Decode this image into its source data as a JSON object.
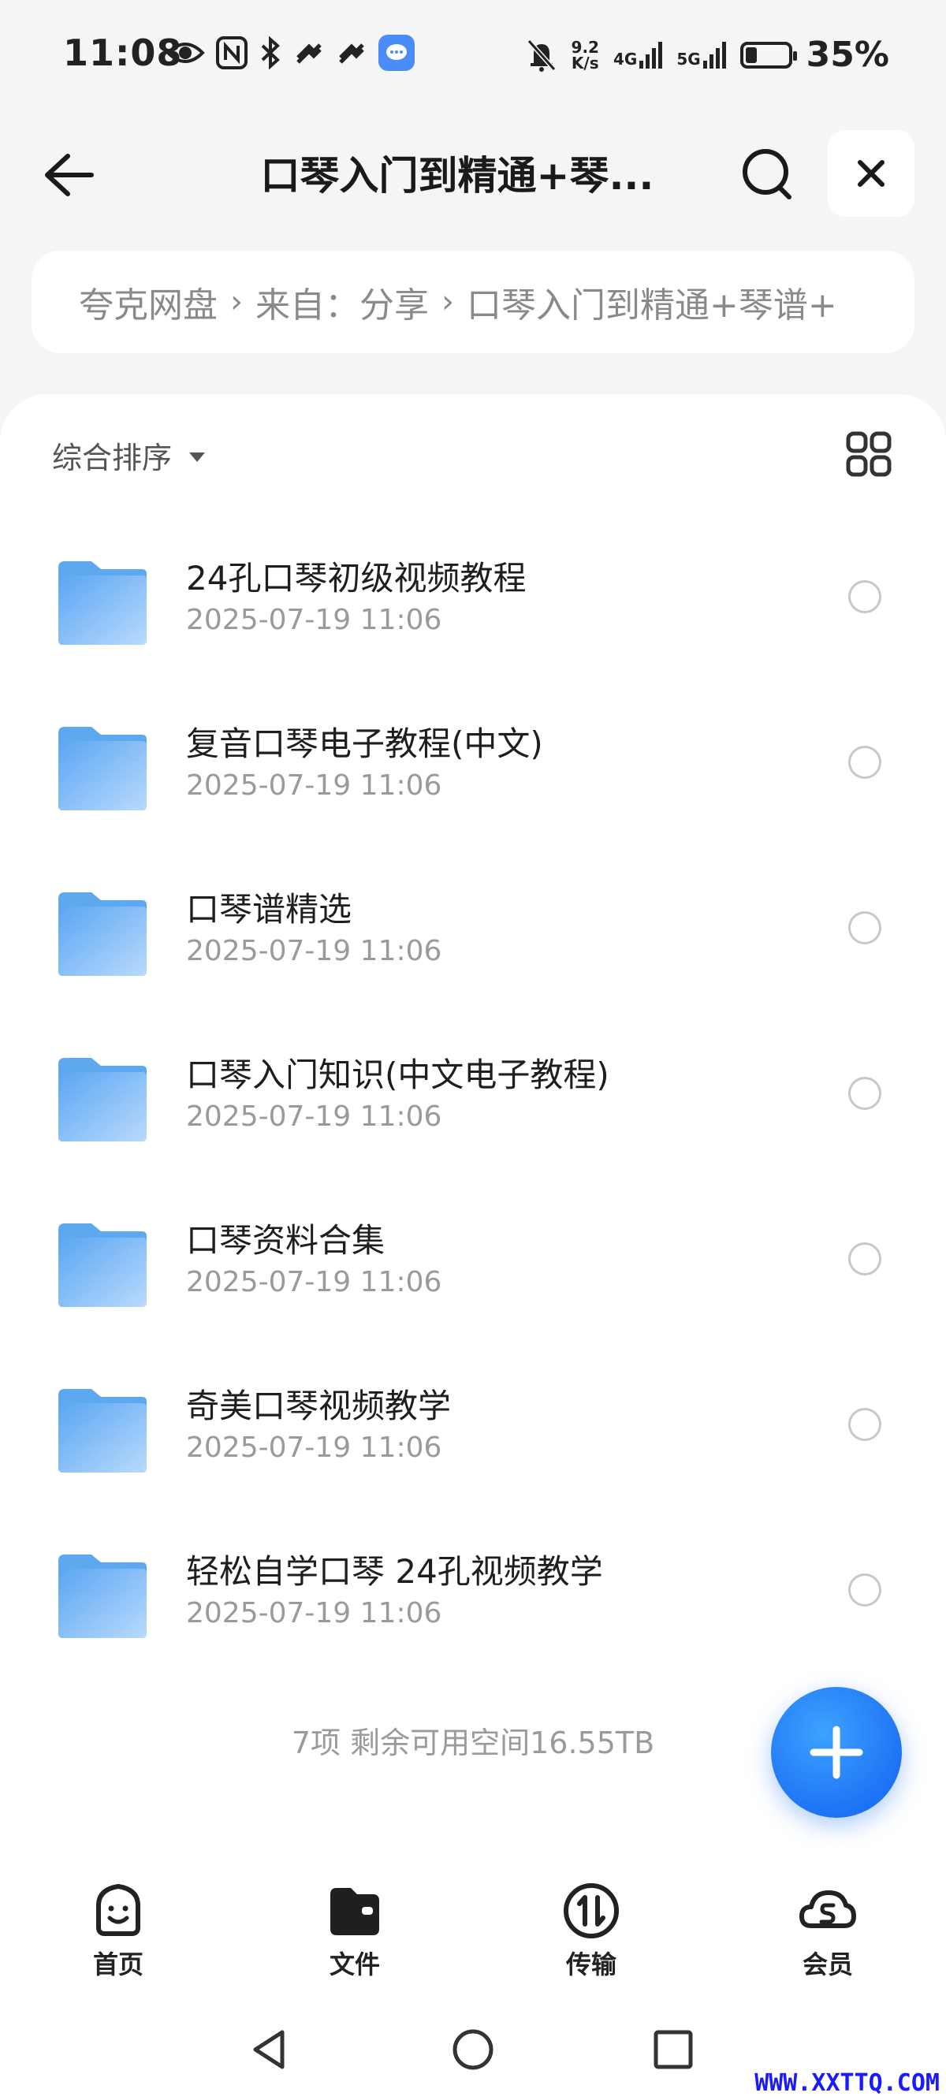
{
  "status_bar": {
    "time": "11:08",
    "net_speed_value": "9.2",
    "net_speed_unit": "K/s",
    "net_4g": "4G",
    "net_5g": "5G",
    "battery_percent": "35%",
    "battery_level": 0.35
  },
  "header": {
    "title": "口琴入门到精通+琴..."
  },
  "breadcrumb": {
    "items": [
      "夸克网盘",
      "来自：分享",
      "口琴入门到精通+琴谱+"
    ]
  },
  "sort": {
    "label": "综合排序"
  },
  "files": [
    {
      "name": "24孔口琴初级视频教程",
      "date": "2025-07-19 11:06"
    },
    {
      "name": "复音口琴电子教程(中文)",
      "date": "2025-07-19 11:06"
    },
    {
      "name": "口琴谱精选",
      "date": "2025-07-19 11:06"
    },
    {
      "name": "口琴入门知识(中文电子教程)",
      "date": "2025-07-19 11:06"
    },
    {
      "name": "口琴资料合集",
      "date": "2025-07-19 11:06"
    },
    {
      "name": "奇美口琴视频教学",
      "date": "2025-07-19 11:06"
    },
    {
      "name": "轻松自学口琴 24孔视频教学",
      "date": "2025-07-19 11:06"
    }
  ],
  "footer": {
    "stats": "7项 剩余可用空间16.55TB"
  },
  "bottom_nav": [
    {
      "label": "首页",
      "icon": "home-smile-icon"
    },
    {
      "label": "文件",
      "icon": "folder-wallet-icon"
    },
    {
      "label": "传输",
      "icon": "transfer-icon"
    },
    {
      "label": "会员",
      "icon": "vip-cloud-icon"
    }
  ],
  "watermark": "WWW.XXTTQ.COM",
  "colors": {
    "accent": "#1f6ff5",
    "folder": "#6fb2f5",
    "background": "#f4f5f7"
  }
}
